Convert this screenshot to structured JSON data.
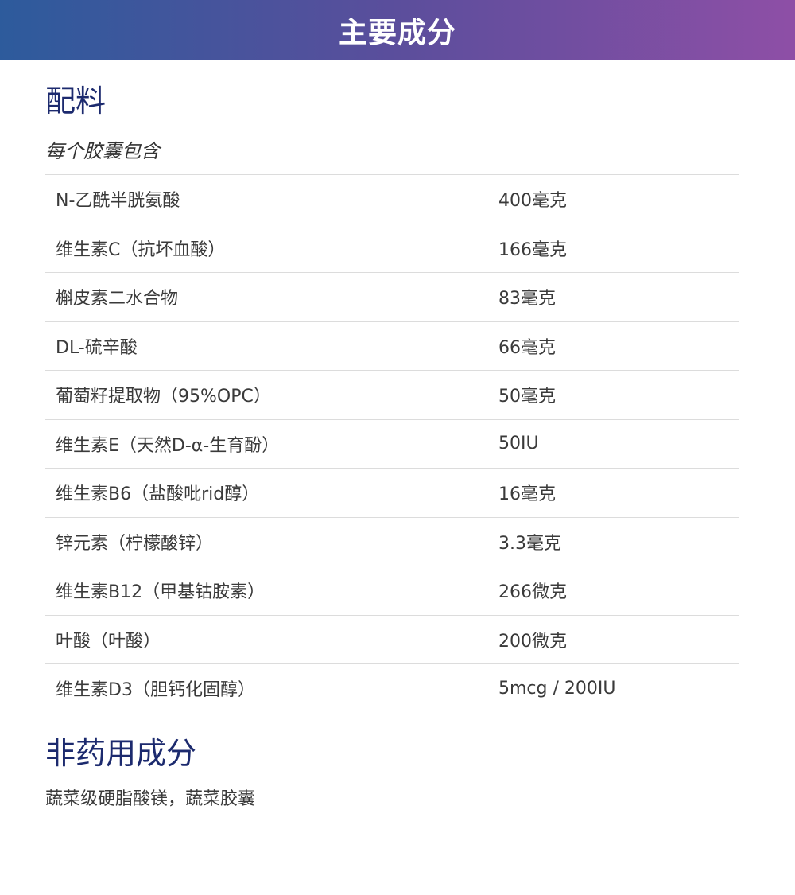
{
  "banner": {
    "title": "主要成分"
  },
  "ingredients": {
    "heading": "配料",
    "subheading": "每个胶囊包含",
    "rows": [
      {
        "name": "N-乙酰半胱氨酸",
        "amount": "400毫克"
      },
      {
        "name": "维生素C（抗坏血酸）",
        "amount": "166毫克"
      },
      {
        "name": "槲皮素二水合物",
        "amount": "83毫克"
      },
      {
        "name": "DL-硫辛酸",
        "amount": "66毫克"
      },
      {
        "name": "葡萄籽提取物（95%OPC）",
        "amount": "50毫克"
      },
      {
        "name": "维生素E（天然D-α-生育酚）",
        "amount": "50IU"
      },
      {
        "name": "维生素B6（盐酸吡rid醇）",
        "amount": "16毫克"
      },
      {
        "name": "锌元素（柠檬酸锌）",
        "amount": "3.3毫克"
      },
      {
        "name": "维生素B12（甲基钴胺素）",
        "amount": "266微克"
      },
      {
        "name": "叶酸（叶酸）",
        "amount": "200微克"
      },
      {
        "name": "维生素D3（胆钙化固醇）",
        "amount": "5mcg / 200IU"
      }
    ]
  },
  "non_medicinal": {
    "heading": "非药用成分",
    "text": "蔬菜级硬脂酸镁，蔬菜胶囊"
  }
}
